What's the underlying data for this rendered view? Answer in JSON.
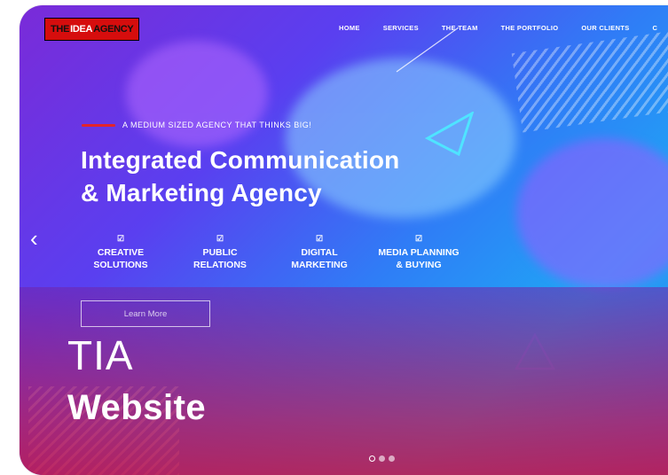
{
  "logo": {
    "text_a": "THE",
    "text_b": "IDEA",
    "text_c": "AGENCY"
  },
  "nav": {
    "items": [
      "HOME",
      "SERVICES",
      "THE TEAM",
      "THE PORTFOLIO",
      "OUR CLIENTS",
      "C"
    ]
  },
  "hero": {
    "tagline": "A MEDIUM SIZED AGENCY THAT THINKS BIG!",
    "headline_line1": "Integrated Communication",
    "headline_line2": "& Marketing Agency",
    "prev_arrow": "‹",
    "check_glyph": "☑",
    "services": [
      {
        "line1": "CREATIVE",
        "line2": "SOLUTIONS"
      },
      {
        "line1": "PUBLIC",
        "line2": "RELATIONS"
      },
      {
        "line1": "DIGITAL",
        "line2": "MARKETING"
      },
      {
        "line1": "MEDIA PLANNING",
        "line2": "& BUYING"
      }
    ],
    "cta_label": "Learn More"
  },
  "caption": {
    "title": "TIA",
    "subtitle": "Website"
  },
  "slider": {
    "dot_count": 3,
    "active_index": 0
  },
  "colors": {
    "accent": "#e3242b",
    "gradient_start": "#7a2bd8",
    "gradient_end": "#1fa6f5",
    "overlay": "#c81446"
  }
}
